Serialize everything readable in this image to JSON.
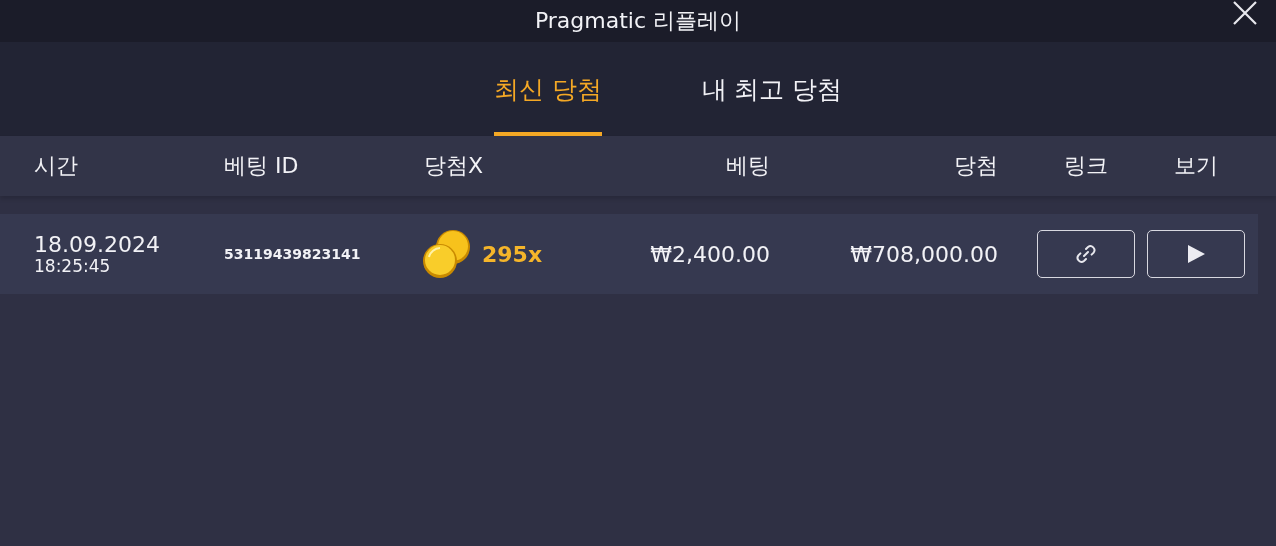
{
  "window": {
    "title": "Pragmatic 리플레이"
  },
  "tabs": [
    {
      "label": "최신 당첨",
      "selected": true
    },
    {
      "label": "내 최고 당첨",
      "selected": false
    }
  ],
  "table": {
    "columns": [
      "시간",
      "베팅 ID",
      "당첨X",
      "베팅",
      "당첨",
      "링크",
      "보기"
    ],
    "rows": [
      {
        "date": "18.09.2024",
        "time": "18:25:45",
        "bet_id": "53119439823141",
        "multiplier": "295x",
        "bet": "₩2,400.00",
        "win": "₩708,000.00"
      }
    ]
  }
}
